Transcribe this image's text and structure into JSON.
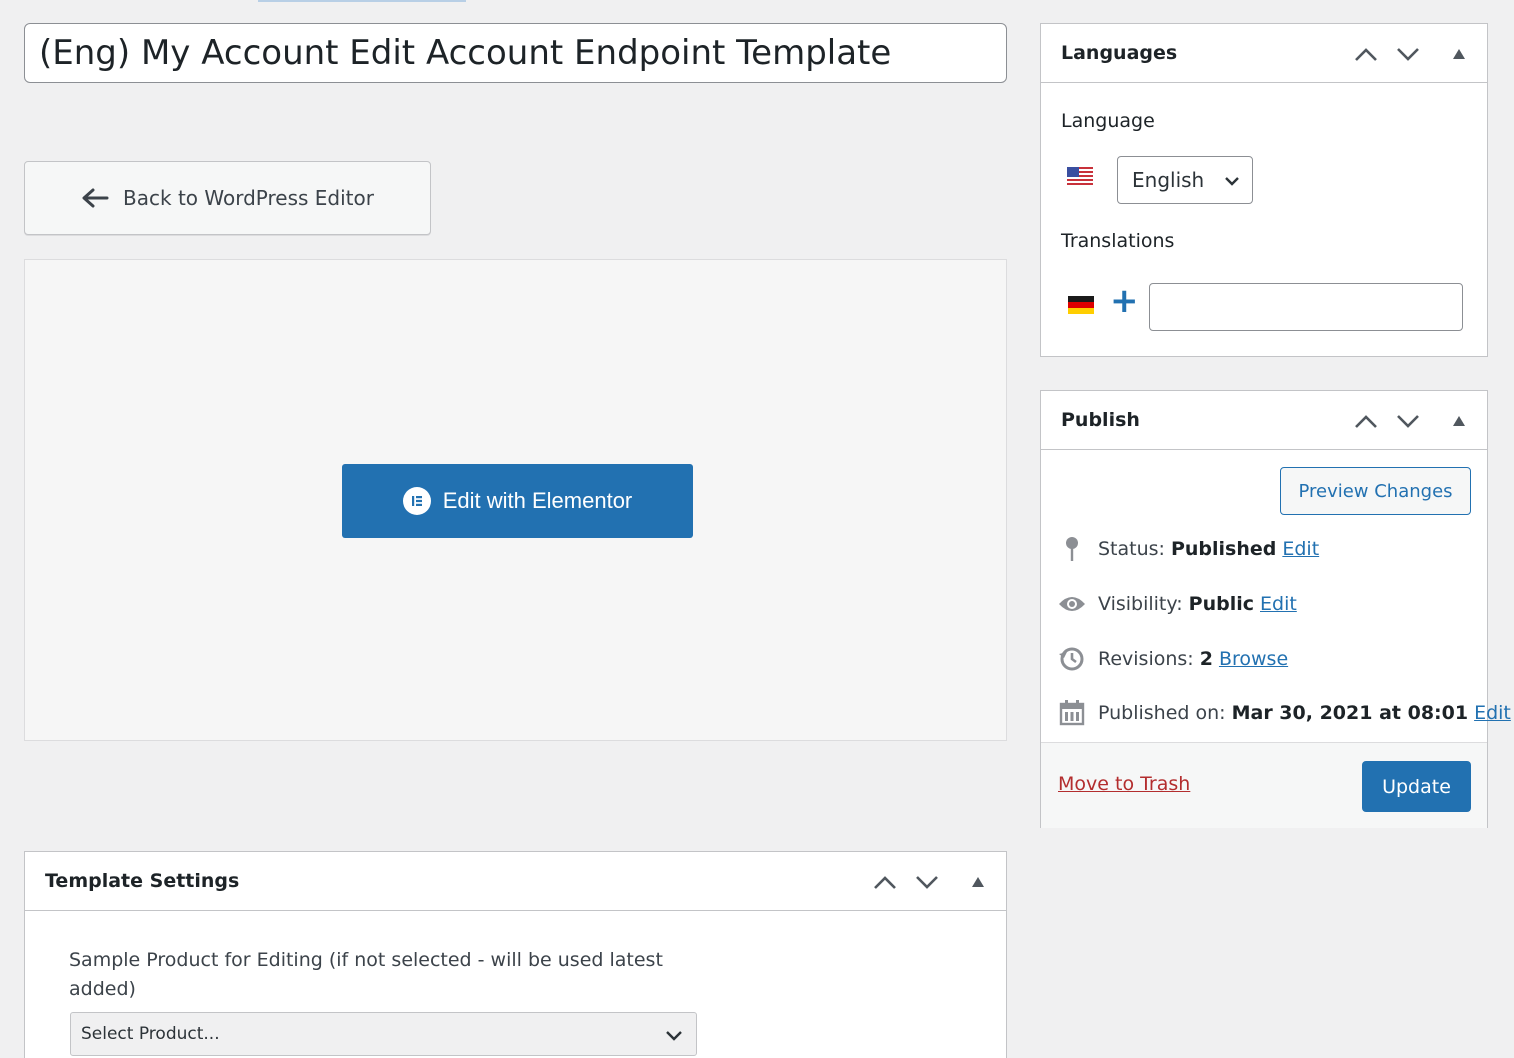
{
  "post": {
    "title": "(Eng) My Account Edit Account Endpoint Template"
  },
  "editor": {
    "back_label": "Back to WordPress Editor",
    "elementor_label": "Edit with Elementor"
  },
  "languages": {
    "title": "Languages",
    "language_label": "Language",
    "selected_language": "English",
    "translations_label": "Translations",
    "translation_value": "",
    "plus": "+"
  },
  "publish": {
    "title": "Publish",
    "preview_label": "Preview Changes",
    "status_label": "Status:",
    "status_value": "Published",
    "status_edit": "Edit",
    "visibility_label": "Visibility:",
    "visibility_value": "Public",
    "visibility_edit": "Edit",
    "revisions_label": "Revisions:",
    "revisions_value": "2",
    "revisions_link": "Browse",
    "published_label": "Published on:",
    "published_value": "Mar 30, 2021 at 08:01",
    "published_edit": "Edit",
    "trash_label": "Move to Trash",
    "update_label": "Update"
  },
  "template_settings": {
    "title": "Template Settings",
    "sample_label": "Sample Product for Editing (if not selected - will be used latest added)",
    "select_value": "Select Product..."
  },
  "colors": {
    "primary": "#2271b1",
    "danger": "#b32d2e",
    "background": "#f0f0f1"
  }
}
